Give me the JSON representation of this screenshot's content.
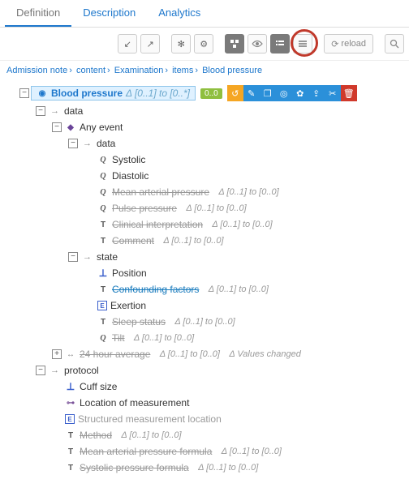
{
  "tabs": {
    "definition": "Definition",
    "description": "Description",
    "analytics": "Analytics"
  },
  "toolbar": {
    "reload": "reload"
  },
  "breadcrumb": [
    "Admission note",
    "content",
    "Examination",
    "items",
    "Blood pressure"
  ],
  "root": {
    "label": "Blood pressure",
    "occ": "Δ [0..1] to [0..*]",
    "pill": "0..0"
  },
  "tree": {
    "data": "data",
    "any_event": "Any event",
    "data2": "data",
    "systolic": "Systolic",
    "diastolic": "Diastolic",
    "map": "Mean arterial pressure",
    "pulse_pressure": "Pulse pressure",
    "clin_interp": "Clinical interpretation",
    "comment": "Comment",
    "state": "state",
    "position": "Position",
    "confounding": "Confounding factors",
    "exertion": "Exertion",
    "sleep_status": "Sleep status",
    "tilt": "Tilt",
    "avg24h": "24 hour average",
    "avg24h_extra": "Δ Values changed",
    "protocol": "protocol",
    "cuff_size": "Cuff size",
    "loc_meas": "Location of measurement",
    "struct_loc": "Structured measurement location",
    "method": "Method",
    "map_formula": "Mean arterial pressure formula",
    "sys_formula": "Systolic pressure formula"
  },
  "occ": {
    "d01_00": "Δ [0..1] to [0..0]"
  }
}
